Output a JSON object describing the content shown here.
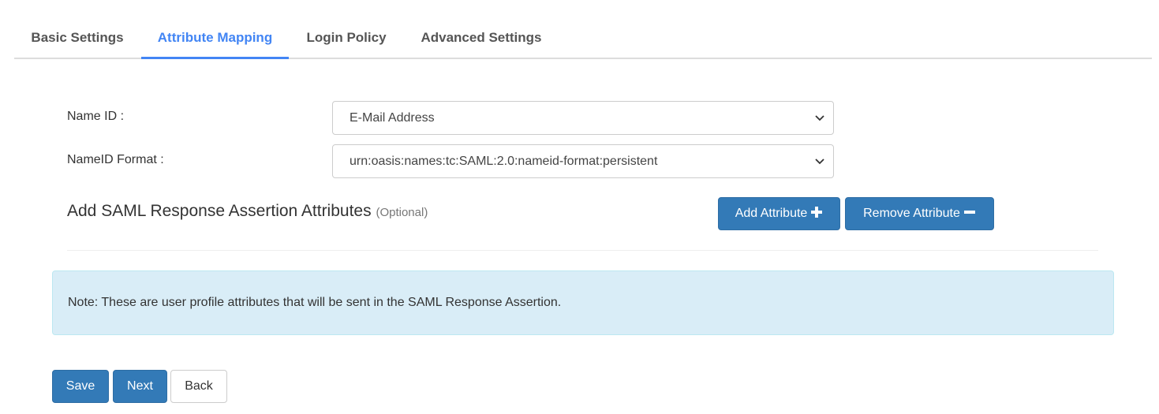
{
  "tabs": [
    {
      "label": "Basic Settings",
      "active": false
    },
    {
      "label": "Attribute Mapping",
      "active": true
    },
    {
      "label": "Login Policy",
      "active": false
    },
    {
      "label": "Advanced Settings",
      "active": false
    }
  ],
  "form": {
    "name_id": {
      "label": "Name ID :",
      "value": "E-Mail Address"
    },
    "name_id_format": {
      "label": "NameID Format :",
      "value": "urn:oasis:names:tc:SAML:2.0:nameid-format:persistent"
    }
  },
  "attributes_section": {
    "title": "Add SAML Response Assertion Attributes",
    "optional": "(Optional)",
    "add_button": "Add Attribute",
    "remove_button": "Remove Attribute"
  },
  "note": "Note: These are user profile attributes that will be sent in the SAML Response Assertion.",
  "actions": {
    "save": "Save",
    "next": "Next",
    "back": "Back"
  },
  "colors": {
    "accent": "#4285f4",
    "primary_button": "#337ab7",
    "info_background": "#d9edf7"
  }
}
